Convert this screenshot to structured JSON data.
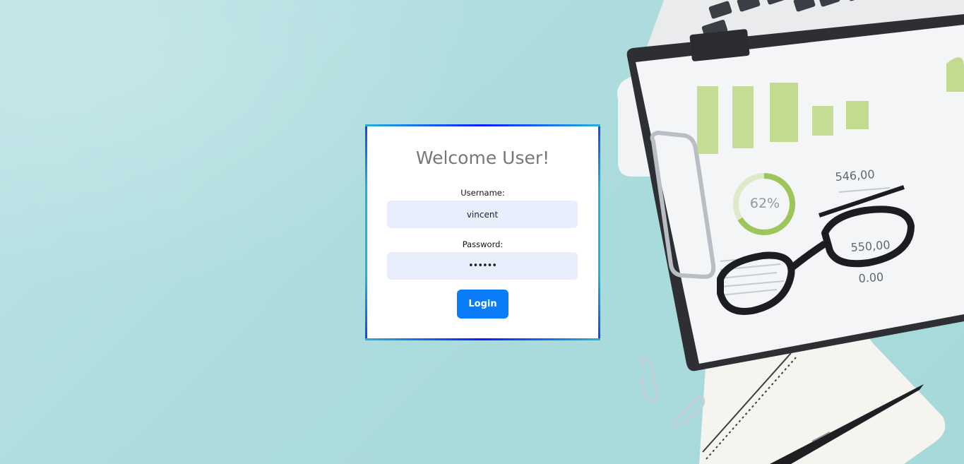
{
  "login": {
    "title": "Welcome User!",
    "username_label": "Username:",
    "username_value": "vincent",
    "password_label": "Password:",
    "password_value": "••••••",
    "login_button": "Login"
  },
  "background": {
    "chart_percent": "62%",
    "value_1": "546,00",
    "value_2": "550,00",
    "value_3": "0.00"
  },
  "colors": {
    "background": "#acdcdd",
    "button": "#0a7cf7",
    "input_bg": "#e8eefb",
    "frame": "#1ab8d8"
  }
}
